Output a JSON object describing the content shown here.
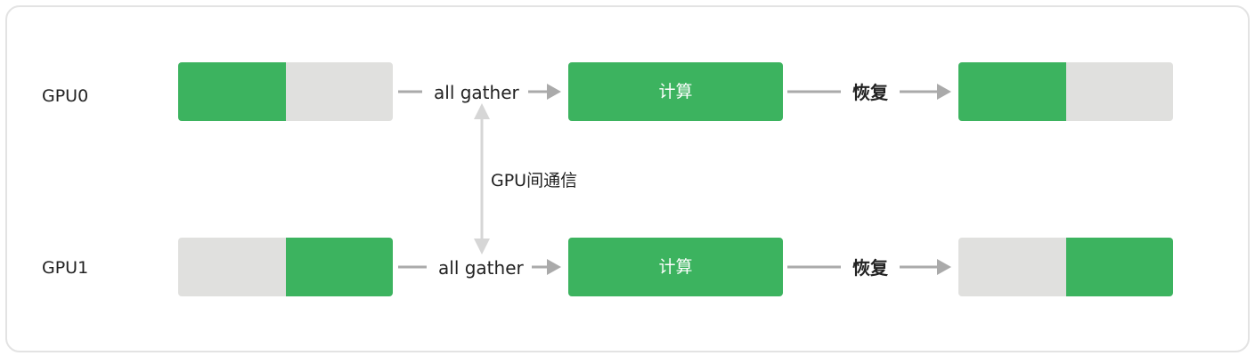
{
  "colors": {
    "filled": "#3cb35f",
    "empty": "#e0e0de",
    "compute": "#3cb35f",
    "arrow": "#aaaaaa",
    "comm_arrow": "#d6d6d6"
  },
  "rows": [
    {
      "gpu": "GPU0",
      "input": [
        "filled",
        "empty"
      ],
      "gather": "all gather",
      "compute": "计算",
      "restore": "恢复",
      "output": [
        "filled",
        "empty"
      ]
    },
    {
      "gpu": "GPU1",
      "input": [
        "empty",
        "filled"
      ],
      "gather": "all gather",
      "compute": "计算",
      "restore": "恢复",
      "output": [
        "empty",
        "filled"
      ]
    }
  ],
  "communication": {
    "label": "GPU间通信"
  }
}
